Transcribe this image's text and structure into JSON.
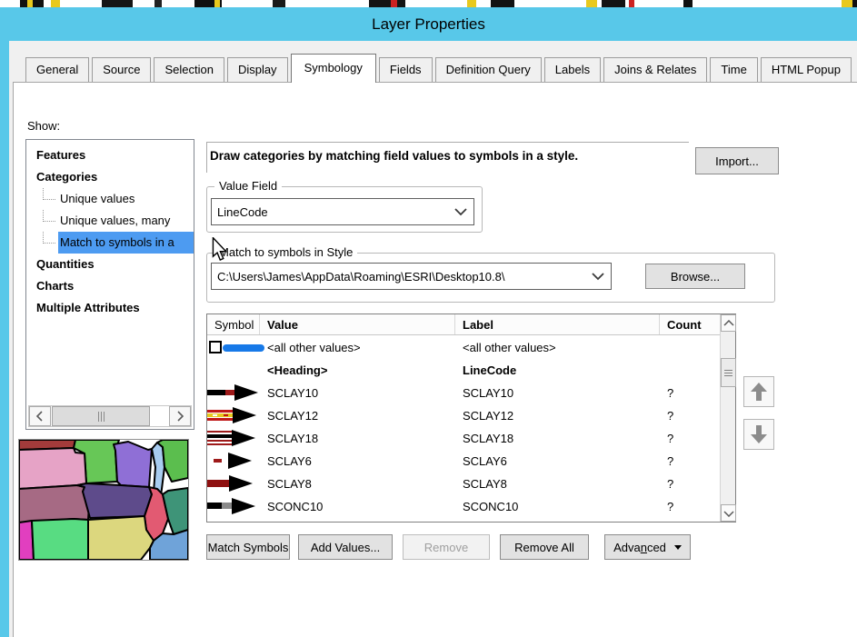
{
  "window": {
    "title": "Layer Properties"
  },
  "tabs": {
    "items": [
      "General",
      "Source",
      "Selection",
      "Display",
      "Symbology",
      "Fields",
      "Definition Query",
      "Labels",
      "Joins & Relates",
      "Time",
      "HTML Popup"
    ],
    "active": "Symbology"
  },
  "show_panel": {
    "label": "Show:",
    "items": [
      {
        "label": "Features",
        "bold": true,
        "indent": 0,
        "selected": false
      },
      {
        "label": "Categories",
        "bold": true,
        "indent": 0,
        "selected": false
      },
      {
        "label": "Unique values",
        "bold": false,
        "indent": 1,
        "selected": false
      },
      {
        "label": "Unique values, many",
        "bold": false,
        "indent": 1,
        "selected": false
      },
      {
        "label": "Match to symbols in a",
        "bold": false,
        "indent": 1,
        "selected": true
      },
      {
        "label": "Quantities",
        "bold": true,
        "indent": 0,
        "selected": false
      },
      {
        "label": "Charts",
        "bold": true,
        "indent": 0,
        "selected": false
      },
      {
        "label": "Multiple Attributes",
        "bold": true,
        "indent": 0,
        "selected": false
      }
    ]
  },
  "main": {
    "instruction": "Draw categories by matching field values to symbols in a style.",
    "import_button": "Import...",
    "value_field": {
      "group_label": "Value Field",
      "selected": "LineCode"
    },
    "style_group": {
      "group_label": "Match to symbols in Style",
      "path": "C:\\Users\\James\\AppData\\Roaming\\ESRI\\Desktop10.8\\",
      "browse_button": "Browse..."
    },
    "symbol_table": {
      "columns": [
        "Symbol",
        "Value",
        "Label",
        "Count"
      ],
      "rows": [
        {
          "symbol": "all-other-values-line",
          "checkbox": true,
          "bold": false,
          "value": "<all other values>",
          "label": "<all other values>",
          "count": ""
        },
        {
          "symbol": "none",
          "checkbox": false,
          "bold": true,
          "value": "<Heading>",
          "label": "LineCode",
          "count": ""
        },
        {
          "symbol": "sclay10-line",
          "checkbox": false,
          "bold": false,
          "value": "SCLAY10",
          "label": "SCLAY10",
          "count": "?"
        },
        {
          "symbol": "sclay12-line",
          "checkbox": false,
          "bold": false,
          "value": "SCLAY12",
          "label": "SCLAY12",
          "count": "?"
        },
        {
          "symbol": "sclay18-line",
          "checkbox": false,
          "bold": false,
          "value": "SCLAY18",
          "label": "SCLAY18",
          "count": "?"
        },
        {
          "symbol": "sclay6-line",
          "checkbox": false,
          "bold": false,
          "value": "SCLAY6",
          "label": "SCLAY6",
          "count": "?"
        },
        {
          "symbol": "sclay8-line",
          "checkbox": false,
          "bold": false,
          "value": "SCLAY8",
          "label": "SCLAY8",
          "count": "?"
        },
        {
          "symbol": "sconc10-line",
          "checkbox": false,
          "bold": false,
          "value": "SCONC10",
          "label": "SCONC10",
          "count": "?"
        }
      ]
    },
    "action_buttons": [
      {
        "label": "Match Symbols",
        "disabled": false,
        "menu": false,
        "mnemonic": ""
      },
      {
        "label": "Add Values...",
        "disabled": false,
        "menu": false,
        "mnemonic": ""
      },
      {
        "label": "Remove",
        "disabled": true,
        "menu": false,
        "mnemonic": ""
      },
      {
        "label": "Remove All",
        "disabled": false,
        "menu": false,
        "mnemonic": ""
      },
      {
        "label": "Advanced",
        "disabled": false,
        "menu": true,
        "mnemonic": "n"
      }
    ]
  },
  "colors": {
    "titlebar": "#58C8E9",
    "selection_blue": "#4D9BF1",
    "symbol_blue": "#1779E8",
    "symbol_darkred": "#9E1A1A"
  }
}
